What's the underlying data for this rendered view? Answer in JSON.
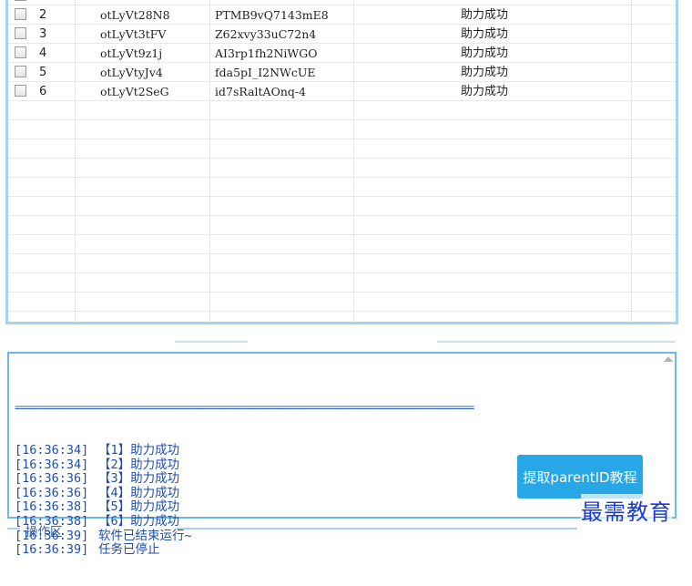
{
  "grid": {
    "rows": [
      {
        "num": "2",
        "id": "otLyVt28N8",
        "code": "PTMB9vQ7143mE8",
        "status": "助力成功"
      },
      {
        "num": "3",
        "id": "otLyVt3tFV",
        "code": "Z62xvy33uC72n4",
        "status": "助力成功"
      },
      {
        "num": "4",
        "id": "otLyVt9z1j",
        "code": "AI3rp1fh2NiWGO",
        "status": "助力成功"
      },
      {
        "num": "5",
        "id": "otLyVtyJv4",
        "code": "fda5pI_I2NWcUE",
        "status": "助力成功"
      },
      {
        "num": "6",
        "id": "otLyVt2SeG",
        "code": "id7sRaltAOnq-4",
        "status": "助力成功"
      }
    ]
  },
  "log": {
    "separator": "=================================================================================",
    "lines": [
      {
        "time": "[16:36:34]",
        "msg": "【1】助力成功"
      },
      {
        "time": "[16:36:34]",
        "msg": "【2】助力成功"
      },
      {
        "time": "[16:36:36]",
        "msg": "【3】助力成功"
      },
      {
        "time": "[16:36:36]",
        "msg": "【4】助力成功"
      },
      {
        "time": "[16:36:38]",
        "msg": "【5】助力成功"
      },
      {
        "time": "[16:36:38]",
        "msg": "【6】助力成功"
      },
      {
        "time": "[16:36:39]",
        "msg": "软件已结束运行~"
      },
      {
        "time": "[16:36:39]",
        "msg": "任务已停止"
      }
    ],
    "guide_button": "提取parentID教程"
  },
  "ops": {
    "label": "操作区"
  },
  "watermark": "最需教育"
}
